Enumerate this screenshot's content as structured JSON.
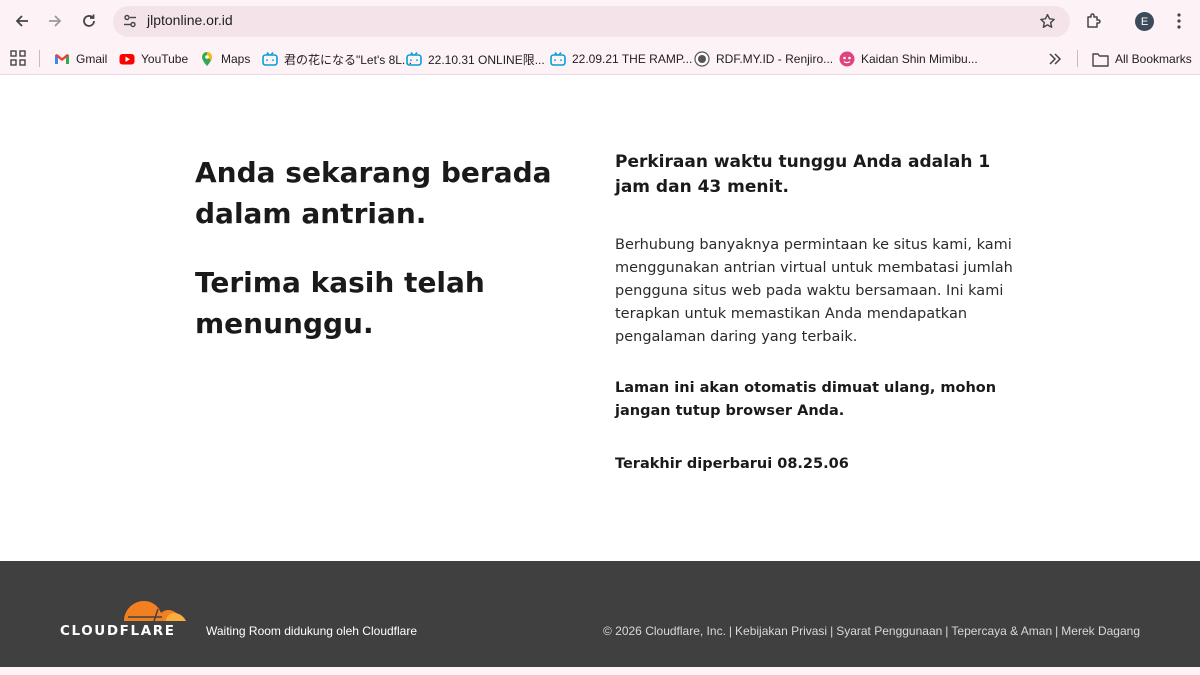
{
  "browser": {
    "url": "jlptonline.or.id",
    "profile_initial": "E",
    "bookmarks": [
      {
        "label": "Gmail",
        "icon": "gmail-icon"
      },
      {
        "label": "YouTube",
        "icon": "youtube-icon"
      },
      {
        "label": "Maps",
        "icon": "maps-icon"
      },
      {
        "label": "君の花になる\"Let's 8L...",
        "icon": "bilibili-icon"
      },
      {
        "label": "22.10.31 ONLINE限...",
        "icon": "bilibili-icon"
      },
      {
        "label": "22.09.21 THE RAMP...",
        "icon": "bilibili-icon"
      },
      {
        "label": "RDF.MY.ID - Renjiro...",
        "icon": "rdf-icon"
      },
      {
        "label": "Kaidan Shin Mimibu...",
        "icon": "pink-face-icon"
      }
    ],
    "all_bookmarks_label": "All Bookmarks"
  },
  "page": {
    "headline_queue": "Anda sekarang berada dalam antrian.",
    "headline_thanks": "Terima kasih telah menunggu.",
    "wait_time": "Perkiraan waktu tunggu Anda adalah 1 jam dan 43 menit.",
    "explanation": "Berhubung banyaknya permintaan ke situs kami, kami menggunakan antrian virtual untuk membatasi jumlah pengguna situs web pada waktu bersamaan. Ini kami terapkan untuk memastikan Anda mendapatkan pengalaman daring yang terbaik.",
    "auto_reload": "Laman ini akan otomatis dimuat ulang, mohon jangan tutup browser Anda.",
    "last_updated": "Terakhir diperbarui 08.25.06"
  },
  "footer": {
    "logo_text": "CLOUDFLARE",
    "powered_by": "Waiting Room didukung oleh Cloudflare",
    "copyright": "© 2026 Cloudflare, Inc.",
    "links": [
      "Kebijakan Privasi",
      "Syarat Penggunaan",
      "Tepercaya & Aman",
      "Merek Dagang"
    ]
  },
  "colors": {
    "chrome_bg": "#fdf2f5",
    "footer_bg": "#404041",
    "cloudflare_orange": "#f38020"
  }
}
